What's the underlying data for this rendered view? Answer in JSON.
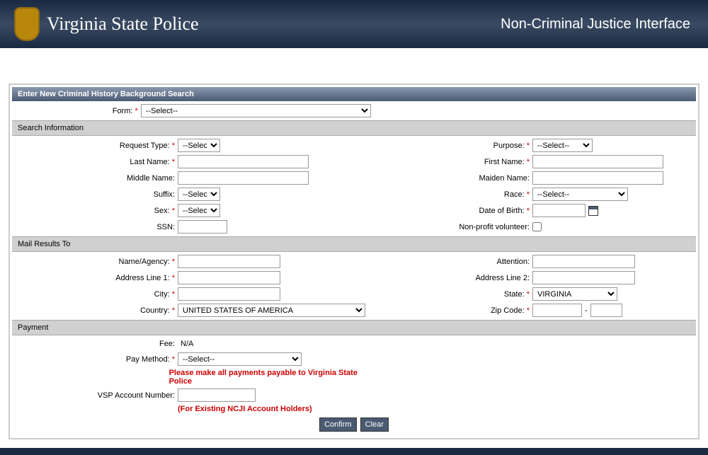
{
  "header": {
    "site_title": "Virginia State Police",
    "interface_title": "Non-Criminal Justice Interface"
  },
  "form_header": "Enter New Criminal History Background Search",
  "sections": {
    "search_info": "Search Information",
    "mail_results": "Mail Results To",
    "payment": "Payment"
  },
  "labels": {
    "form": "Form:",
    "request_type": "Request Type:",
    "purpose": "Purpose:",
    "last_name": "Last Name:",
    "first_name": "First Name:",
    "middle_name": "Middle Name:",
    "maiden_name": "Maiden Name:",
    "suffix": "Suffix:",
    "race": "Race:",
    "sex": "Sex:",
    "date_of_birth": "Date of Birth:",
    "ssn": "SSN:",
    "non_profit": "Non-profit volunteer:",
    "name_agency": "Name/Agency:",
    "attention": "Attention:",
    "address1": "Address Line 1:",
    "address2": "Address Line 2:",
    "city": "City:",
    "state": "State:",
    "country": "Country:",
    "zip": "Zip Code:",
    "fee": "Fee:",
    "pay_method": "Pay Method:",
    "vsp_account": "VSP Account Number:"
  },
  "values": {
    "form_select": "--Select--",
    "request_type_select": "--Select--",
    "purpose_select": "--Select--",
    "suffix_select": "--Select--",
    "race_select": "--Select--",
    "sex_select": "--Select--",
    "state_select": "VIRGINIA",
    "country_select": "UNITED STATES OF AMERICA",
    "pay_method_select": "--Select--",
    "fee_value": "N/A",
    "zip_sep": "-"
  },
  "notes": {
    "payment_note": "Please make all payments payable to Virginia State Police",
    "vsp_note": "(For Existing NCJI Account Holders)"
  },
  "buttons": {
    "confirm": "Confirm",
    "clear": "Clear"
  },
  "required": "*"
}
